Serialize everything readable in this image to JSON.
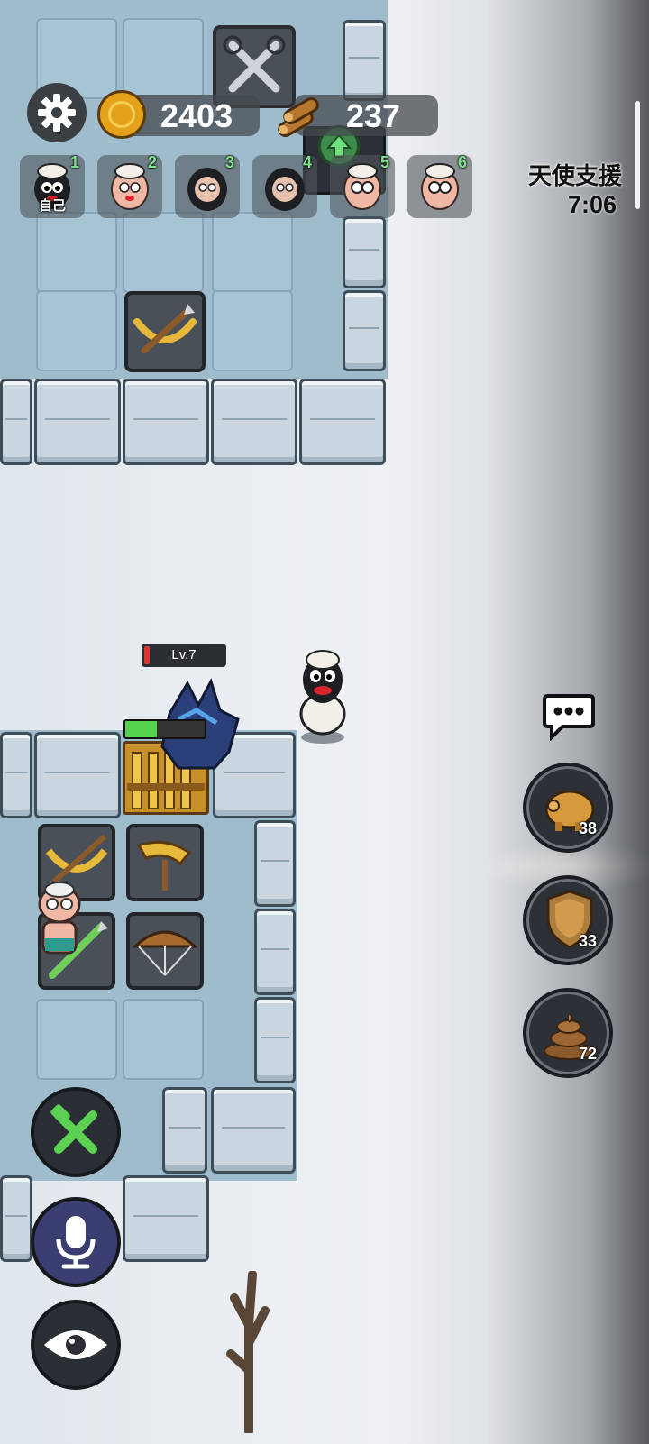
{
  "resources": {
    "coins": "2403",
    "wood": "237"
  },
  "players": [
    {
      "num": "1",
      "label": "自己",
      "style": "black-face"
    },
    {
      "num": "2",
      "label": "",
      "style": "pink-face"
    },
    {
      "num": "3",
      "label": "",
      "style": "dark-hood"
    },
    {
      "num": "4",
      "label": "",
      "style": "dark-hood"
    },
    {
      "num": "5",
      "label": "",
      "style": "glasses"
    },
    {
      "num": "6",
      "label": "",
      "style": "glasses"
    }
  ],
  "angel_support": {
    "label": "天使支援",
    "timer": "7:06"
  },
  "enemy": {
    "level_label": "Lv.7",
    "hp_fraction": 0.4
  },
  "side_items": [
    {
      "icon": "piggy-bank-icon",
      "count": "38"
    },
    {
      "icon": "shield-icon",
      "count": "33"
    },
    {
      "icon": "poop-icon",
      "count": "72"
    }
  ],
  "ui_icons": {
    "settings": "gear-icon",
    "chat": "chat-bubble-icon",
    "build": "hammer-wrench-icon",
    "voice": "microphone-icon",
    "view": "eye-icon"
  },
  "colors": {
    "hud_dark": "#3a3f44",
    "accent_green": "#56d24f",
    "coin_gold": "#e4a21b"
  }
}
